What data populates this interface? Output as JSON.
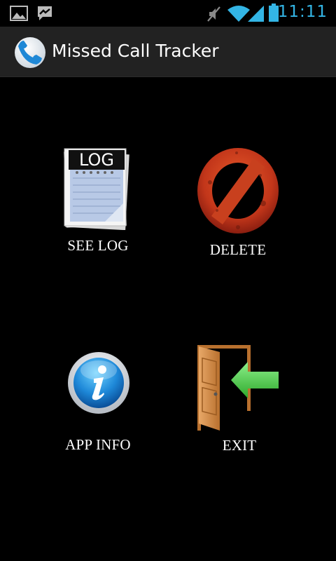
{
  "status_bar": {
    "time": "11:11",
    "icons": [
      "gallery-notification-icon",
      "hangouts-notification-icon",
      "mute-icon",
      "wifi-icon",
      "signal-icon",
      "battery-icon"
    ],
    "accent_color": "#33b5e5"
  },
  "action_bar": {
    "title": "Missed Call Tracker",
    "logo_icon": "phone-handset-icon"
  },
  "menu": {
    "see_log": {
      "label": "SEE LOG",
      "icon": "log-notepad-icon",
      "icon_text": "LOG"
    },
    "delete": {
      "label": "DELETE",
      "icon": "no-sign-icon"
    },
    "app_info": {
      "label": "APP INFO",
      "icon": "info-icon"
    },
    "exit": {
      "label": "EXIT",
      "icon": "exit-door-icon"
    }
  }
}
